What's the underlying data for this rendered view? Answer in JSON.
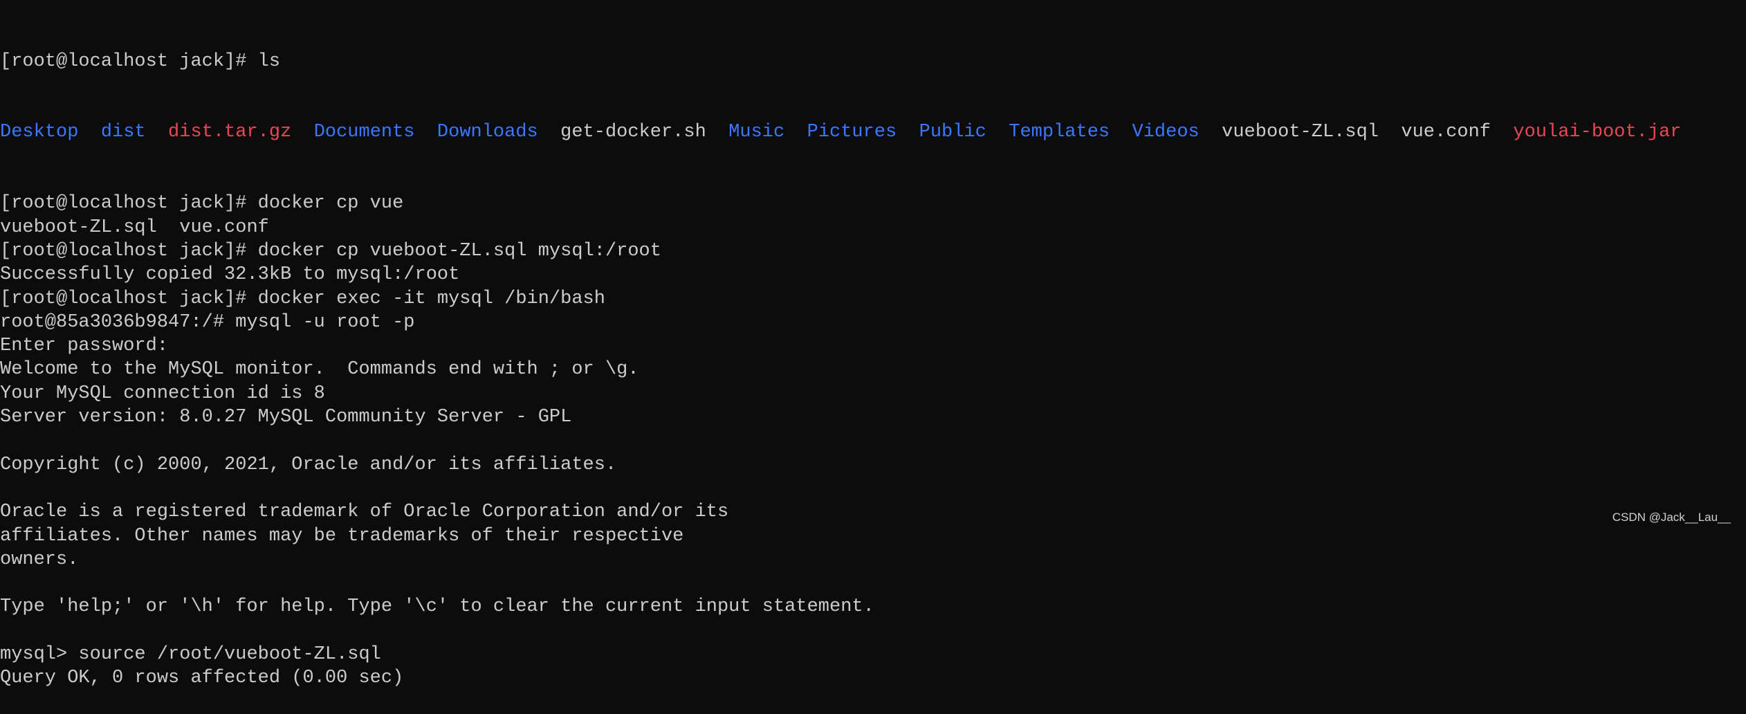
{
  "prompt": "[root@localhost jack]# ",
  "colors": {
    "background": "#0c0c0c",
    "text": "#cccccc",
    "directory": "#3b78ff",
    "archive": "#e74856"
  },
  "ls_command": "ls",
  "ls_output": [
    {
      "name": "Desktop",
      "type": "directory"
    },
    {
      "name": "dist",
      "type": "directory"
    },
    {
      "name": "dist.tar.gz",
      "type": "archive"
    },
    {
      "name": "Documents",
      "type": "directory"
    },
    {
      "name": "Downloads",
      "type": "directory"
    },
    {
      "name": "get-docker.sh",
      "type": "file"
    },
    {
      "name": "Music",
      "type": "directory"
    },
    {
      "name": "Pictures",
      "type": "directory"
    },
    {
      "name": "Public",
      "type": "directory"
    },
    {
      "name": "Templates",
      "type": "directory"
    },
    {
      "name": "Videos",
      "type": "directory"
    },
    {
      "name": "vueboot-ZL.sql",
      "type": "file"
    },
    {
      "name": "vue.conf",
      "type": "file"
    },
    {
      "name": "youlai-boot.jar",
      "type": "archive"
    }
  ],
  "lines": [
    "[root@localhost jack]# docker cp vue",
    "vueboot-ZL.sql  vue.conf",
    "[root@localhost jack]# docker cp vueboot-ZL.sql mysql:/root",
    "Successfully copied 32.3kB to mysql:/root",
    "[root@localhost jack]# docker exec -it mysql /bin/bash",
    "root@85a3036b9847:/# mysql -u root -p",
    "Enter password:",
    "Welcome to the MySQL monitor.  Commands end with ; or \\g.",
    "Your MySQL connection id is 8",
    "Server version: 8.0.27 MySQL Community Server - GPL",
    "",
    "Copyright (c) 2000, 2021, Oracle and/or its affiliates.",
    "",
    "Oracle is a registered trademark of Oracle Corporation and/or its",
    "affiliates. Other names may be trademarks of their respective",
    "owners.",
    "",
    "Type 'help;' or '\\h' for help. Type '\\c' to clear the current input statement.",
    "",
    "mysql> source /root/vueboot-ZL.sql",
    "Query OK, 0 rows affected (0.00 sec)"
  ],
  "watermark": "CSDN @Jack__Lau__"
}
